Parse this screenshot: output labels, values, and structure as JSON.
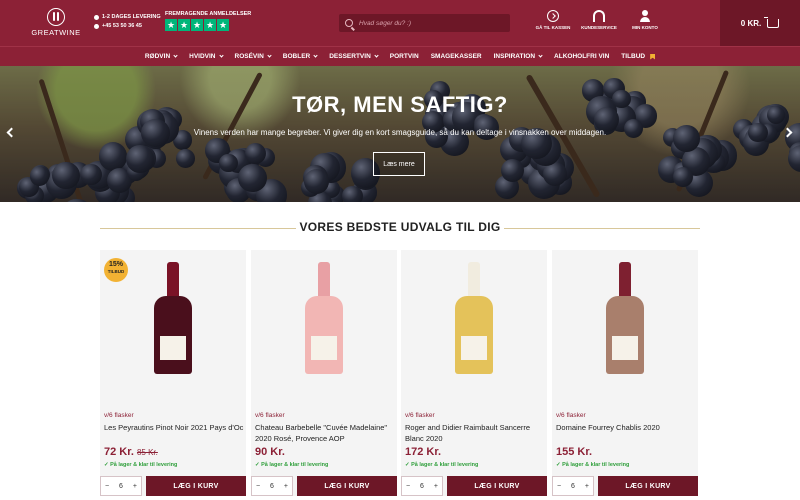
{
  "header": {
    "logo": "GREATWINE",
    "delivery": "1-2 DAGES LEVERING",
    "phone": "+45 53 50 36 45",
    "trustpilot_label": "FREMRAGENDE ANMELDELSER",
    "search_placeholder": "Hvad søger du? :)",
    "links": [
      {
        "label": "GÅ TIL KASSEN",
        "icon": "arrow-right-circle-icon"
      },
      {
        "label": "KUNDESERVICE",
        "icon": "headset-icon"
      },
      {
        "label": "MIN KONTO",
        "icon": "user-icon"
      }
    ],
    "cart_total": "0 KR."
  },
  "nav": {
    "items": [
      {
        "label": "RØDVIN",
        "dropdown": true
      },
      {
        "label": "HVIDVIN",
        "dropdown": true
      },
      {
        "label": "ROSÉVIN",
        "dropdown": true
      },
      {
        "label": "BOBLER",
        "dropdown": true
      },
      {
        "label": "DESSERTVIN",
        "dropdown": true
      },
      {
        "label": "PORTVIN",
        "dropdown": false
      },
      {
        "label": "SMAGEKASSER",
        "dropdown": false
      },
      {
        "label": "INSPIRATION",
        "dropdown": true
      },
      {
        "label": "ALKOHOLFRI VIN",
        "dropdown": false
      },
      {
        "label": "TILBUD",
        "dropdown": false,
        "icon": "tag-icon"
      }
    ]
  },
  "hero": {
    "title": "TØR, MEN SAFTIG?",
    "subtitle": "Vinens verden har mange begreber. Vi giver dig en kort smagsguide, så du kan deltage i vinsnakken over middagen.",
    "button": "Læs mere"
  },
  "section": {
    "title": "VORES BEDSTE UDVALG TIL DIG"
  },
  "products": [
    {
      "cases": "v/6 flasker",
      "name": "Les Peyrautins Pinot Noir 2021 Pays d'Oc",
      "price": "72 Kr.",
      "old_price": "85 Kr.",
      "stock": "✓ På lager & klar til levering",
      "qty": "6",
      "button": "LÆG I KURV",
      "badge": {
        "pct": "15%",
        "text": "TILBUD"
      },
      "bottle_color": "#4a0f1c",
      "neck_color": "#7a1226"
    },
    {
      "cases": "v/6 flasker",
      "name": "Chateau Barbebelle \"Cuvée Madelaine\" 2020 Rosé, Provence AOP",
      "price": "90 Kr.",
      "stock": "✓ På lager & klar til levering",
      "qty": "6",
      "button": "LÆG I KURV",
      "bottle_color": "#f2b6b4",
      "neck_color": "#e8a0a4"
    },
    {
      "cases": "v/6 flasker",
      "name": "Roger and Didier Raimbault Sancerre Blanc 2020",
      "price": "172 Kr.",
      "stock": "✓ På lager & klar til levering",
      "qty": "6",
      "button": "LÆG I KURV",
      "bottle_color": "#e4c25a",
      "neck_color": "#f1ecdf"
    },
    {
      "cases": "v/6 flasker",
      "name": "Domaine Fourrey Chablis 2020",
      "price": "155 Kr.",
      "stock": "✓ På lager & klar til levering",
      "qty": "6",
      "button": "LÆG I KURV",
      "bottle_color": "#a97f6c",
      "neck_color": "#7e2030"
    }
  ]
}
